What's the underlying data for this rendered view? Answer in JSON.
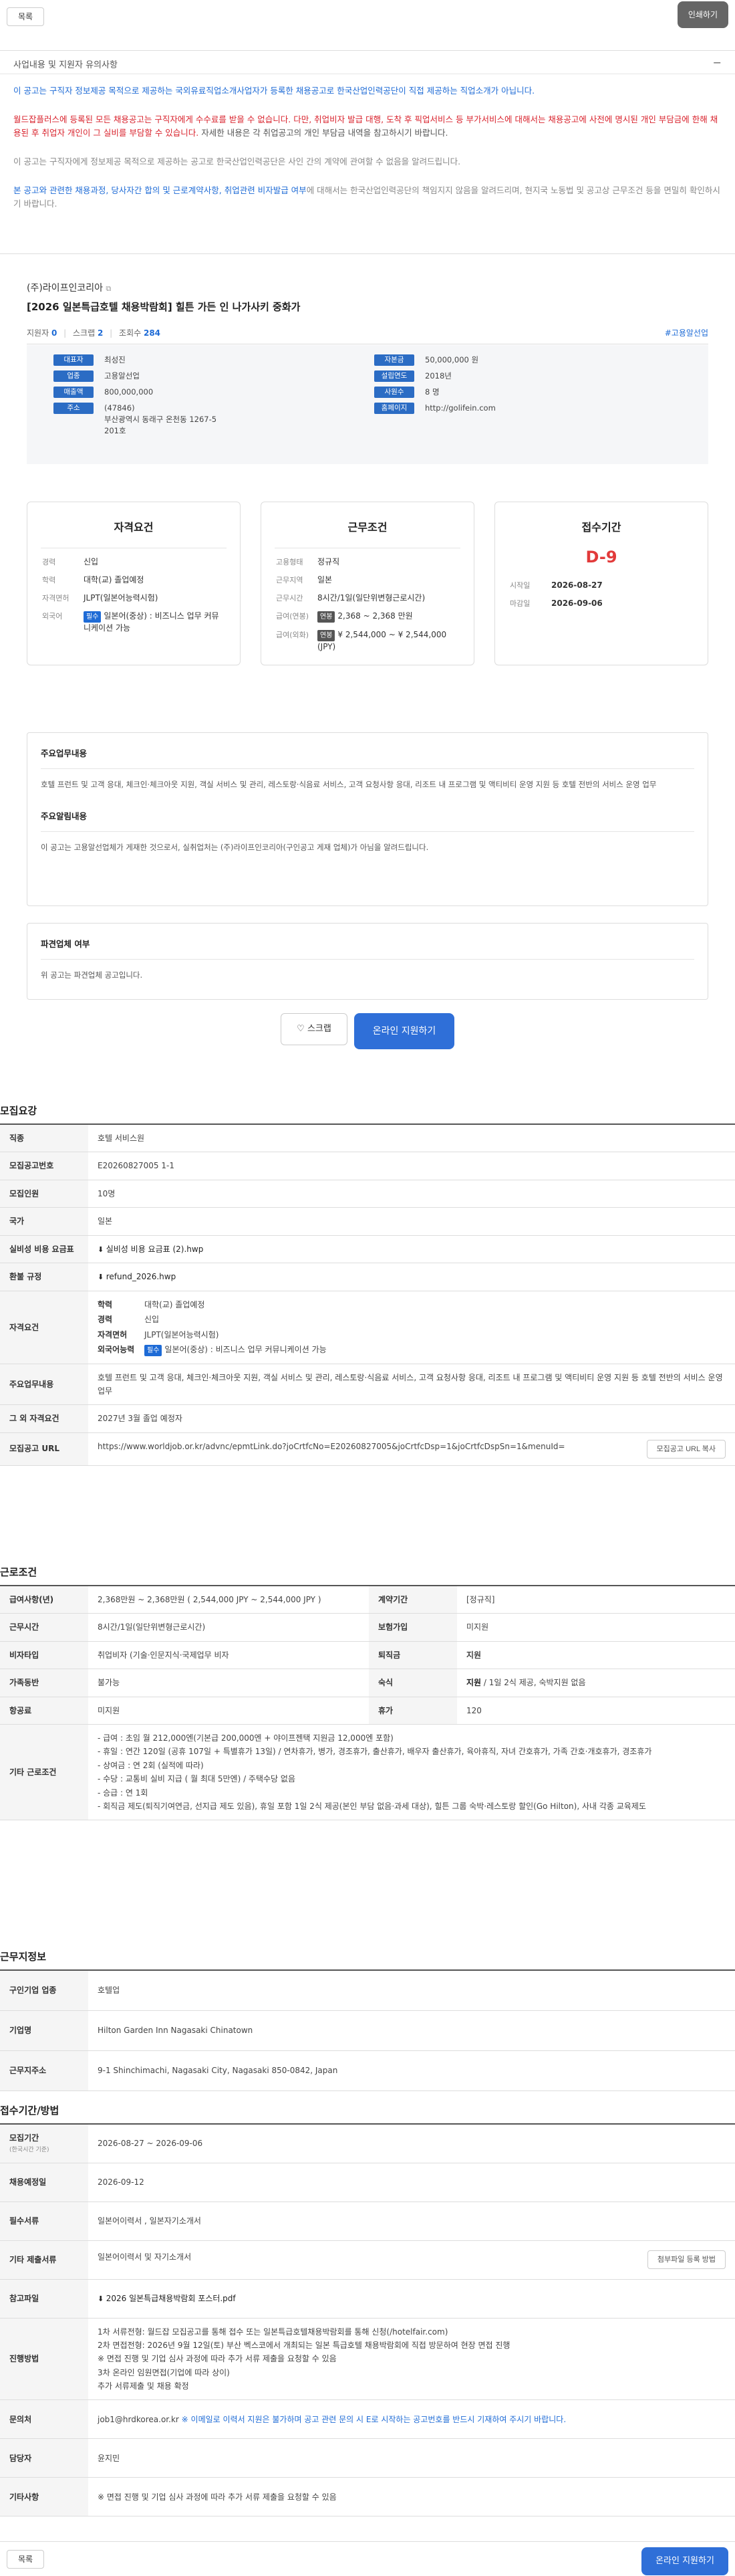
{
  "topbar": {
    "list_label": "목록",
    "print_label": "인쇄하기"
  },
  "notice": {
    "title": "사업내용 및 지원자 유의사항",
    "collapse_icon": "minus-icon",
    "p1": "이 공고는 구직자 정보제공 목적으로 제공하는 국외유료직업소개사업자가 등록한 채용공고로 한국산업인력공단이 직접 제공하는 직업소개가 아닙니다.",
    "p2": "월드잡플러스에 등록된 모든 채용공고는 구직자에게 수수료를 받을 수 없습니다. 다만, 취업비자 발급 대행, 도착 후 픽업서비스 등 부가서비스에 대해서는 채용공고에 사전에 명시된 개인 부담금에 한해 채용된 후 취업자 개인이 그 실비를 부담할 수 있습니다.",
    "p2_gray": "자세한 내용은 각 취업공고의 개인 부담금 내역을 참고하시기 바랍니다.",
    "p3": "이 공고는 구직자에게 정보제공 목적으로 제공하는 공고로 한국산업인력공단은 사인 간의 계약에 관여할 수 없음을 알려드립니다.",
    "p4_link": "본 공고와 관련한 채용과정, 당사자간 합의 및 근로계약사항, 취업관련 비자발급 여부",
    "p4_rest": "에 대해서는 한국산업인력공단의 책임지지 않음을 알려드리며, 현지국 노동법 및 공고상 근무조건 등을 면밀히 확인하시기 바랍니다."
  },
  "summary": {
    "company": "(주)라이프인코리아",
    "company_icon": "external-link-icon",
    "title": "[2026 일본특급호텔 채용박람회] 힐튼 가든 인 나가사키 중화가",
    "stats": {
      "applicants_label": "지원자",
      "applicants": "0",
      "scrap_label": "스크랩",
      "scrap": "2",
      "views_label": "조회수",
      "views": "284",
      "tag": "#고용알선업"
    },
    "info_left": [
      {
        "k": "대표자",
        "v": "최성진"
      },
      {
        "k": "업종",
        "v": "고용알선업"
      },
      {
        "k": "매출액",
        "v": "800,000,000"
      },
      {
        "k": "주소",
        "v": "(47846)\n부산광역시 동래구 온천동 1267-5 201호"
      }
    ],
    "info_right": [
      {
        "k": "자본금",
        "v": "50,000,000 원"
      },
      {
        "k": "설립연도",
        "v": "2018년"
      },
      {
        "k": "사원수",
        "v": "8 명"
      },
      {
        "k": "홈페이지",
        "v": "http://golifein.com"
      }
    ]
  },
  "card_qual": {
    "title": "자격요건",
    "rows": [
      {
        "k": "경력",
        "v": "신입"
      },
      {
        "k": "학력",
        "v": "대학(교) 졸업예정"
      },
      {
        "k": "자격면허",
        "v": "JLPT(일본어능력시험)"
      },
      {
        "k": "외국어",
        "tag": "필수",
        "v": "일본어(중상) : 비즈니스 업무 커뮤니케이션 가능"
      }
    ]
  },
  "card_cond": {
    "title": "근무조건",
    "rows": [
      {
        "k": "고용형태",
        "v": "정규직"
      },
      {
        "k": "근무지역",
        "v": "일본"
      },
      {
        "k": "근무시간",
        "v": "8시간/1일(일단위변형근로시간)"
      },
      {
        "k": "급여(연봉)",
        "tag": "연봉",
        "v": "2,368 ~ 2,368 만원"
      },
      {
        "k": "급여(외화)",
        "tag": "연봉",
        "v": "¥ 2,544,000 ~ ¥ 2,544,000 (JPY)"
      }
    ]
  },
  "card_period": {
    "title": "접수기간",
    "dday": "D-9",
    "start_k": "시작일",
    "start_v": "2026-08-27",
    "end_k": "마감일",
    "end_v": "2026-09-06"
  },
  "duties": {
    "title": "주요업무내용",
    "text": "호텔 프런트 및 고객 응대, 체크인·체크아웃 지원, 객실 서비스 및 관리, 레스토랑·식음료 서비스, 고객 요청사항 응대, 리조트 내 프로그램 및 액티비티 운영 지원 등 호텔 전반의 서비스 운영 업무",
    "title2": "주요알림내용",
    "text2": "이 공고는 고용알선업체가 게재한 것으로서, 실취업처는 (주)라이프인코리아(구인공고 게재 업체)가 아님을 알려드립니다."
  },
  "dispatch": {
    "title": "파견업체 여부",
    "text": "위 공고는 파견업체 공고입니다."
  },
  "actions": {
    "scrap_label": "스크랩",
    "scrap_icon": "heart-icon",
    "apply_label": "온라인 지원하기"
  },
  "recruit": {
    "title": "모집요강",
    "job_k": "직종",
    "job_v": "호텔 서비스원",
    "no_k": "모집공고번호",
    "no_v": "E20260827005 1-1",
    "count_k": "모집인원",
    "count_v": "10명",
    "country_k": "국가",
    "country_v": "일본",
    "fee_k": "실비성 비용 요금표",
    "fee_v": "실비성 비용 요금표 (2).hwp",
    "refund_k": "환불 규정",
    "refund_v": "refund_2026.hwp",
    "qual_k": "자격요건",
    "qual": [
      {
        "k": "학력",
        "v": "대학(교) 졸업예정"
      },
      {
        "k": "경력",
        "v": "신입"
      },
      {
        "k": "자격면허",
        "v": "JLPT(일본어능력시험)"
      },
      {
        "k": "외국어능력",
        "tag": "필수",
        "v": "일본어(중상) : 비즈니스 업무 커뮤니케이션 가능"
      }
    ],
    "duty_k": "주요업무내용",
    "duty_v": "호텔 프런트 및 고객 응대, 체크인·체크아웃 지원, 객실 서비스 및 관리, 레스토랑·식음료 서비스, 고객 요청사항 응대, 리조트 내 프로그램 및 액티비티 운영 지원 등 호텔 전반의 서비스 운영 업무",
    "etc_k": "그 외 자격요건",
    "etc_v": "2027년 3월 졸업 예정자",
    "url_k": "모집공고 URL",
    "url_v": "https://www.worldjob.or.kr/advnc/epmtLink.do?joCrtfcNo=E20260827005&joCrtfcDsp=1&joCrtfcDspSn=1&menuId=",
    "url_btn": "모집공고 URL 복사"
  },
  "work": {
    "title": "근로조건",
    "salary_k": "급여사항(년)",
    "salary_v": "2,368만원 ~ 2,368만원 ( 2,544,000 JPY ~ 2,544,000 JPY )",
    "contract_k": "계약기간",
    "contract_v": "[정규직]",
    "hours_k": "근무시간",
    "hours_v": "8시간/1일(일단위변형근로시간)",
    "insurance_k": "보험가입",
    "insurance_v": "미지원",
    "visa_k": "비자타입",
    "visa_v": "취업비자 (기술·인문지식·국제업무 비자",
    "severance_k": "퇴직금",
    "severance_v": "지원",
    "family_k": "가족동반",
    "family_v": "불가능",
    "lodging_k": "숙식",
    "lodging_b": "지원",
    "lodging_v": " / 1일 2식 제공, 숙박지원 없음",
    "flight_k": "항공료",
    "flight_v": "미지원",
    "holiday_k": "휴가",
    "holiday_v": "120",
    "other_k": "기타 근로조건",
    "other_lines": [
      "- 급여 : 초임 월 212,000엔(기본급 200,000엔 + 야이프젠택 지원금 12,000엔 포함)",
      "- 휴일 : 연간 120일 (공휴 107일 + 특별휴가 13일) / 연차휴가, 병가, 경조휴가, 출산휴가, 배우자 출산휴가, 육아휴직, 자녀 간호휴가, 가족 간호·개호휴가, 경조휴가",
      "- 상여금 : 연 2회 (실적에 따라)",
      "- 수당 : 교통비 실비 지급 ( 월 최대 5만엔) / 주택수당 없음",
      "- 승급 : 연 1회",
      "- 회직금 제도(퇴직기여연금, 선지급 제도 있음), 휴일 포함 1일 2식 제공(본인 부담 없음·과세 대상), 힐튼 그룹 숙박·레스토랑 할인(Go Hilton), 사내 각종 교육제도"
    ]
  },
  "workplace": {
    "title": "근무지정보",
    "industry_k": "구인기업 업종",
    "industry_v": "호텔업",
    "company_k": "기업명",
    "company_v": "Hilton Garden Inn Nagasaki Chinatown",
    "address_k": "근무지주소",
    "address_v": "9-1 Shinchimachi, Nagasaki City, Nagasaki 850-0842, Japan"
  },
  "apply": {
    "title": "접수기간/방법",
    "period_k": "모집기간",
    "period_sub": "(한국시간 기준)",
    "period_v": "2026-08-27 ~ 2026-09-06",
    "hire_k": "채용예정일",
    "hire_v": "2026-09-12",
    "docs_k": "필수서류",
    "docs_v": "일본어이력서 , 일본자기소개서",
    "etcdocs_k": "기타 제출서류",
    "etcdocs_v": "일본어이력서 및 자기소개서",
    "etcdocs_btn": "첨부파일 등록 방법",
    "file_k": "참고파일",
    "file_v": "2026 일본특급채용박람회 포스터.pdf",
    "process_k": "진행방법",
    "process_lines": [
      "1차 서류전형: 월드잡 모집공고를 통해 접수 또는 일본특급호텔채용박람회를 통해 신청(/hotelfair.com)",
      "2차 면접전형: 2026년 9월 12일(토) 부산 벡스코에서 개최되는 일본 특급호텔 채용박람회에 직접 방문하여 현장 면접 진행",
      "※ 면접 진행 및 기업 심사 과정에 따라 추가 서류 제출을 요청할 수 있음",
      "3차 온라인 임원면접(기업에 따라 상이)",
      "추가 서류제출 및 채용 확정"
    ],
    "contact_k": "문의처",
    "contact_v": "job1@hrdkorea.or.kr",
    "contact_note": "※ 이메일로 이력서 지원은 불가하며 공고 관련 문의 시 E로 시작하는 공고번호를 반드시 기재하여 주시기 바랍니다.",
    "manager_k": "담당자",
    "manager_v": "윤지민",
    "misc_k": "기타사항",
    "misc_v": "※ 면접 진행 및 기업 심사 과정에 따라 추가 서류 제출을 요청할 수 있음"
  },
  "bottombar": {
    "list_label": "목록",
    "apply_label": "온라인 지원하기"
  }
}
